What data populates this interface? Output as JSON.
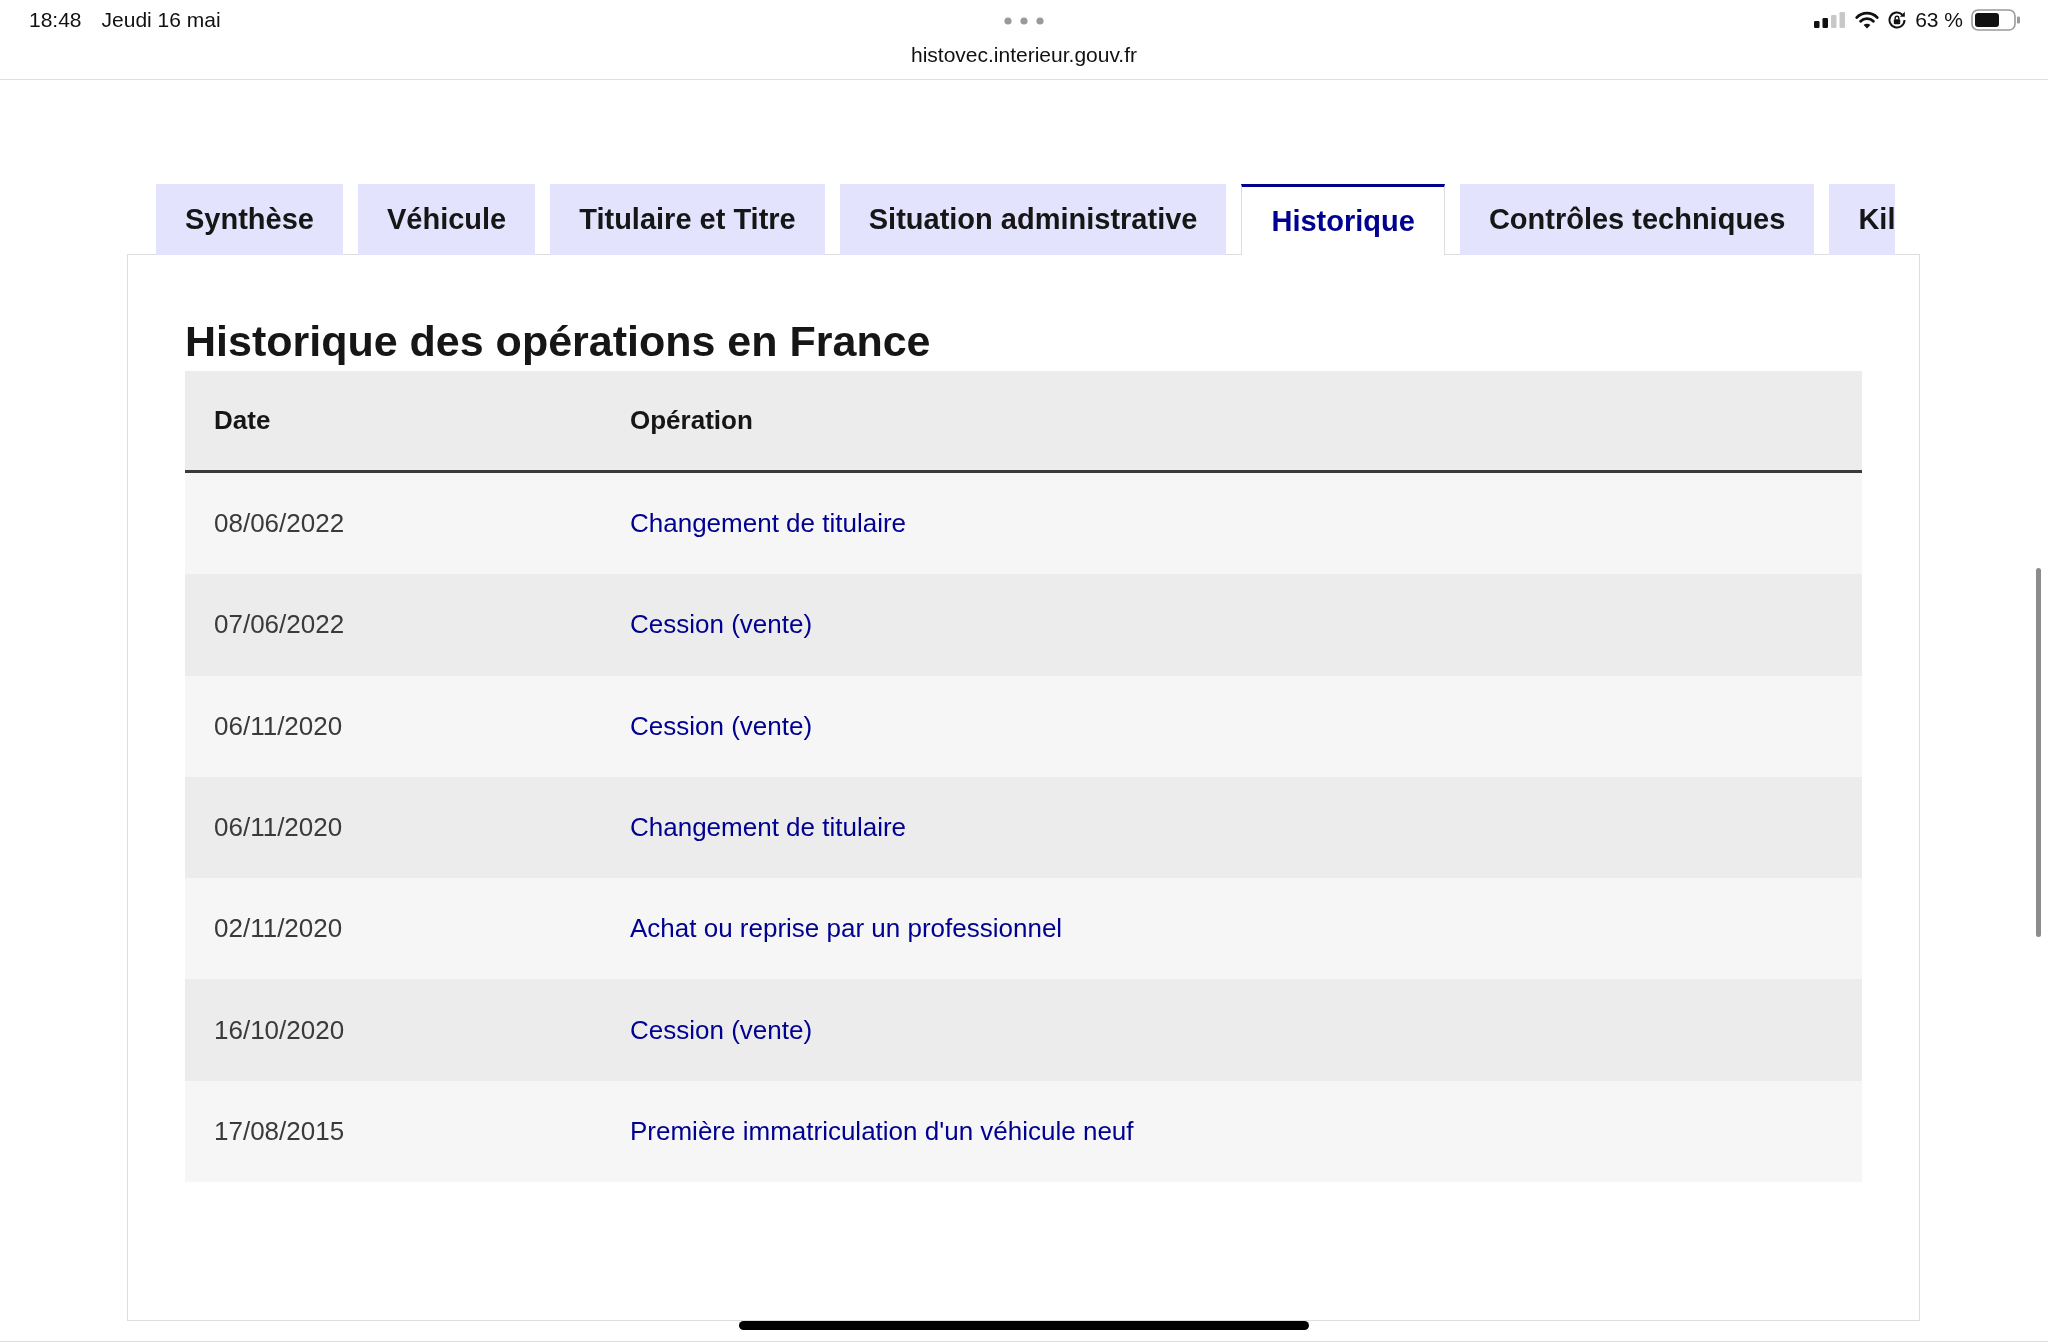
{
  "status_bar": {
    "time": "18:48",
    "date": "Jeudi 16 mai",
    "battery_percent": "63 %"
  },
  "browser": {
    "url": "histovec.interieur.gouv.fr"
  },
  "tabs": [
    {
      "label": "Synthèse",
      "selected": false
    },
    {
      "label": "Véhicule",
      "selected": false
    },
    {
      "label": "Titulaire et Titre",
      "selected": false
    },
    {
      "label": "Situation administrative",
      "selected": false
    },
    {
      "label": "Historique",
      "selected": true
    },
    {
      "label": "Contrôles techniques",
      "selected": false
    },
    {
      "label": "Kil",
      "selected": false
    }
  ],
  "section": {
    "title": "Historique des opérations en France",
    "table": {
      "columns": [
        "Date",
        "Opération"
      ],
      "rows": [
        {
          "date": "08/06/2022",
          "operation": "Changement de titulaire"
        },
        {
          "date": "07/06/2022",
          "operation": "Cession (vente)"
        },
        {
          "date": "06/11/2020",
          "operation": "Cession (vente)"
        },
        {
          "date": "06/11/2020",
          "operation": "Changement de titulaire"
        },
        {
          "date": "02/11/2020",
          "operation": "Achat ou reprise par un professionnel"
        },
        {
          "date": "16/10/2020",
          "operation": "Cession (vente)"
        },
        {
          "date": "17/08/2015",
          "operation": "Première immatriculation d'un véhicule neuf"
        }
      ]
    }
  }
}
